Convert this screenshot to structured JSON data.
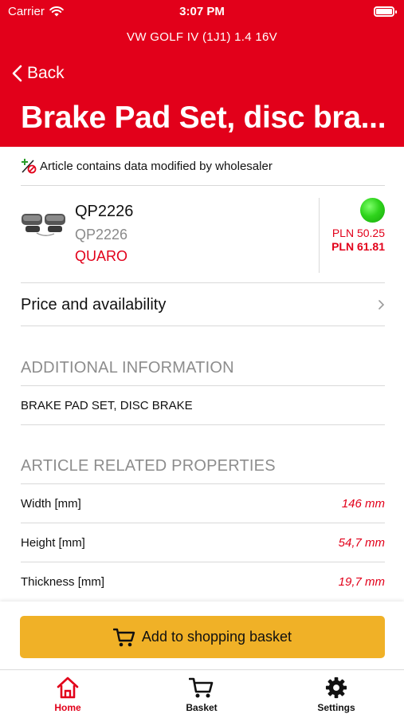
{
  "status_bar": {
    "carrier": "Carrier",
    "time": "3:07 PM"
  },
  "header": {
    "vehicle": "VW GOLF IV (1J1) 1.4 16V",
    "back_label": "Back",
    "title": "Brake Pad Set, disc bra..."
  },
  "notice": "Article contains data modified by wholesaler",
  "product": {
    "code": "QP2226",
    "subcode": "QP2226",
    "brand": "QUARO",
    "price_1": "PLN 50.25",
    "price_2": "PLN 61.81",
    "availability_color": "#2fd41c"
  },
  "price_availability_label": "Price and availability",
  "additional_info": {
    "heading": "ADDITIONAL INFORMATION",
    "text": "BRAKE PAD SET, DISC BRAKE"
  },
  "properties": {
    "heading": "ARTICLE RELATED PROPERTIES",
    "rows": [
      {
        "label": "Width [mm]",
        "value": "146 mm"
      },
      {
        "label": "Height [mm]",
        "value": "54,7 mm"
      },
      {
        "label": "Thickness [mm]",
        "value": "19,7 mm"
      }
    ]
  },
  "add_to_basket_label": "Add to shopping basket",
  "tabs": [
    {
      "label": "Home",
      "icon": "home-icon",
      "active": true
    },
    {
      "label": "Basket",
      "icon": "cart-icon",
      "active": false
    },
    {
      "label": "Settings",
      "icon": "gear-icon",
      "active": false
    }
  ],
  "colors": {
    "brand_red": "#e2001a",
    "button_yellow": "#f0b127"
  }
}
